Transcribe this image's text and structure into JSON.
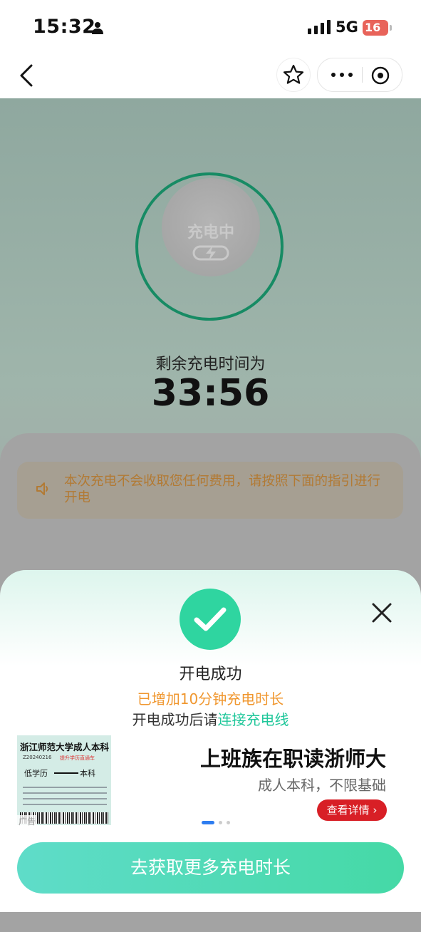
{
  "status_bar": {
    "time": "15:32",
    "network": "5G",
    "battery": "16"
  },
  "charging": {
    "state_label": "充电中",
    "remaining_label": "剩余充电时间为",
    "remaining_time": "33:56",
    "notice": "本次充电不会收取您任何费用，请按照下面的指引进行开电"
  },
  "sheet": {
    "title": "开电成功",
    "added": "已增加10分钟充电时长",
    "hint_prefix": "开电成功后请",
    "hint_link": "连接充电线",
    "cta": "去获取更多充电时长"
  },
  "ad": {
    "image_title": "浙江师范大学成人本科",
    "image_code": "Z20240216",
    "image_tag": "提升学历直通车",
    "image_from": "低学历",
    "image_to": "本科",
    "tag": "广告",
    "title": "上班族在职读浙师大",
    "subtitle": "成人本科，不限基础",
    "button": "查看详情"
  },
  "colors": {
    "accent": "#2fd5a0",
    "ring": "#178b64",
    "warning": "#f0972f",
    "ad_button": "#d81f26"
  }
}
